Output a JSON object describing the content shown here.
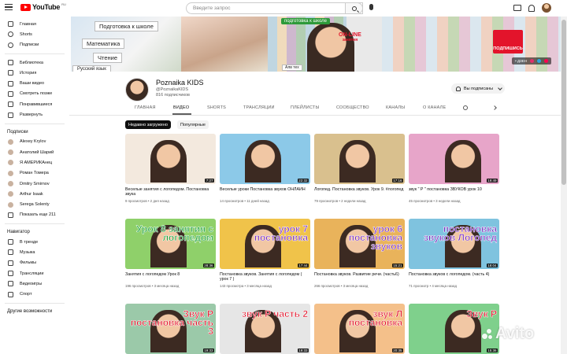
{
  "topbar": {
    "logo_text": "YouTube",
    "logo_region": "RU",
    "search_placeholder": "Введите запрос"
  },
  "sidebar": {
    "main": [
      "Главная",
      "Shorts",
      "Подписки"
    ],
    "library": [
      "Библиотека",
      "История",
      "Ваши видео",
      "Смотреть позже",
      "Понравившиеся",
      "Развернуть"
    ],
    "subs_header": "Подписки",
    "subs": [
      "Alexey Krylov",
      "Анатолий Шарий",
      "Я АМЕРИКАнец",
      "Роман Томера",
      "Dmitry Smirnov",
      "Arthur Isaak",
      "Serega Solenty"
    ],
    "subs_more": "Показать еще 211",
    "nav_header": "Навигатор",
    "nav": [
      "В тренде",
      "Музыка",
      "Фильмы",
      "Трансляции",
      "Видеоигры",
      "Спорт"
    ],
    "more_header": "Другие возможности"
  },
  "banner": {
    "sign1": "Подготовка к школе",
    "sign2": "Математика",
    "sign3": "Чтение",
    "sign4": "Русский язык",
    "green_sign": "подготовка к школе",
    "online": "ON-LINE",
    "online_sub": "занятия",
    "rules_sign": "Алв тех",
    "subscribe": "ПОДПИШИСЬ",
    "links_label": "• ДЗЕН"
  },
  "channel": {
    "name": "Poznaika KIDS",
    "handle": "@PoznaikaKIDS",
    "subscribers": "816 подписчиков",
    "subscribed_label": "Вы подписаны"
  },
  "tabs": [
    "ГЛАВНАЯ",
    "ВИДЕО",
    "SHORTS",
    "ТРАНСЛЯЦИИ",
    "ПЛЕЙЛИСТЫ",
    "СООБЩЕСТВО",
    "КАНАЛЫ",
    "О КАНАЛЕ"
  ],
  "active_tab": "ВИДЕО",
  "chips": [
    "Недавно загружено",
    "Популярные"
  ],
  "videos": [
    {
      "title": "Веселые занятия с логопедом. Постановка звука",
      "meta": "9 просмотров • 2 дня назад",
      "duration": "7:27",
      "thumb_text": "",
      "thumb_color": "#f3e9de"
    },
    {
      "title": "Веселые уроки Постановка звуков ОНЛАЙН",
      "meta": "14 просмотров • 11 дней назад",
      "duration": "22:32",
      "thumb_text": "",
      "thumb_color": "#8cc9e8"
    },
    {
      "title": "Логопед. Постановка звуков. Урок 9. #логопед",
      "meta": "79 просмотров • 2 недели назад",
      "duration": "17:16",
      "thumb_text": "",
      "thumb_color": "#d9c08e"
    },
    {
      "title": "звук \" Р \" постановка ЗВУКОВ урок 10",
      "meta": "45 просмотров • 3 недели назад",
      "duration": "19:49",
      "thumb_text": "",
      "thumb_color": "#e7a5c9"
    },
    {
      "title": "Занятия с логопедом Урок 8",
      "meta": "196 просмотров • 3 месяца назад",
      "duration": "28:36",
      "thumb_text": "Урок 8 занятия с логопедом",
      "thumb_color": "#8fd06a"
    },
    {
      "title": "Постановка звуков. Занятия с логопедом ( урок 7 )",
      "meta": "143 просмотра • 3 месяца назад",
      "duration": "17:44",
      "thumb_text": "урок 7 постановка",
      "thumb_color": "#f0c34a"
    },
    {
      "title": "Постановка звуков. Развитие речи. (часть6)",
      "meta": "266 просмотров • 3 месяца назад",
      "duration": "15:21",
      "thumb_text": "урок 6 постановка звуков",
      "thumb_color": "#e9b35b"
    },
    {
      "title": "Постановка звуков с логопедом. (часть 4)",
      "meta": "71 просмотр • 4 месяца назад",
      "duration": "18:04",
      "thumb_text": "постановка звуков Логопед",
      "thumb_color": "#7fc3df"
    },
    {
      "title": "",
      "meta": "",
      "duration": "19:33",
      "thumb_text": "Звук Р постановка часть 3",
      "thumb_color": "#9bc9a9"
    },
    {
      "title": "",
      "meta": "",
      "duration": "19:33",
      "thumb_text": "звук Р часть 2",
      "thumb_color": "#e6e6e6"
    },
    {
      "title": "",
      "meta": "",
      "duration": "20:35",
      "thumb_text": "звук Л постановка",
      "thumb_color": "#f4c08a"
    },
    {
      "title": "",
      "meta": "",
      "duration": "15:36",
      "thumb_text": "Звук Р",
      "thumb_color": "#7fd08c"
    }
  ],
  "watermark": "Avito"
}
